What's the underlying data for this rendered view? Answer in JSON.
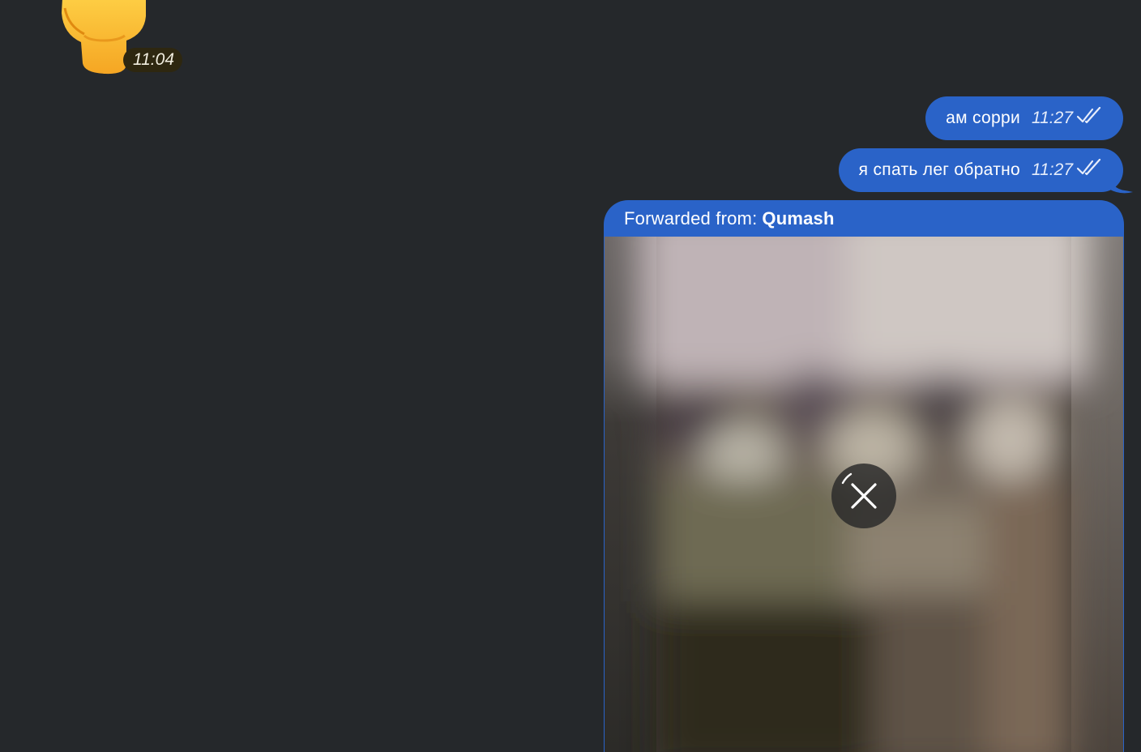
{
  "incoming": {
    "sticker": {
      "icon": "raised-fist-emoji-icon",
      "time": "11:04"
    }
  },
  "outgoing": [
    {
      "text": "ам сорри",
      "time": "11:27",
      "status_icon": "double-check-icon"
    },
    {
      "text": "я спать лег обратно",
      "time": "11:27",
      "status_icon": "double-check-icon"
    }
  ],
  "forwarded": {
    "label": "Forwarded from:",
    "from_name": "Qumash",
    "media": {
      "type": "video",
      "state": "loading",
      "action_icon": "cancel-download-icon"
    }
  },
  "colors": {
    "background": "#25282b",
    "outgoing_bubble": "#2a63c8",
    "sticker_time_badge": "#2e2710"
  }
}
